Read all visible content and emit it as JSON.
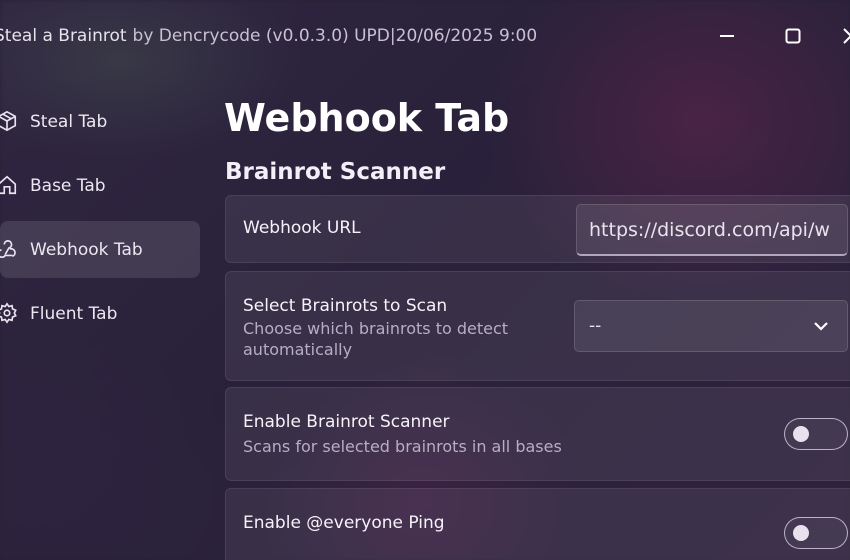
{
  "window": {
    "title": "Steal a Brainrot",
    "subtitle": "by Dencrycode (v0.0.3.0) UPD|20/06/2025 9:00"
  },
  "sidebar": {
    "items": [
      {
        "label": "Steal Tab",
        "icon": "package-icon",
        "active": false
      },
      {
        "label": "Base Tab",
        "icon": "home-icon",
        "active": false
      },
      {
        "label": "Webhook Tab",
        "icon": "webhook-icon",
        "active": true
      },
      {
        "label": "Fluent Tab",
        "icon": "gear-icon",
        "active": false
      }
    ]
  },
  "main": {
    "page_title": "Webhook Tab",
    "section_title": "Brainrot Scanner",
    "webhook_url": {
      "label": "Webhook URL",
      "value": "https://discord.com/api/w"
    },
    "select_brainrots": {
      "label": "Select Brainrots to Scan",
      "description": "Choose which brainrots to detect automatically",
      "selected": "--"
    },
    "enable_scanner": {
      "label": "Enable Brainrot Scanner",
      "description": "Scans for selected brainrots in all bases",
      "enabled": false
    },
    "enable_ping": {
      "label": "Enable @everyone Ping",
      "enabled": false
    }
  }
}
